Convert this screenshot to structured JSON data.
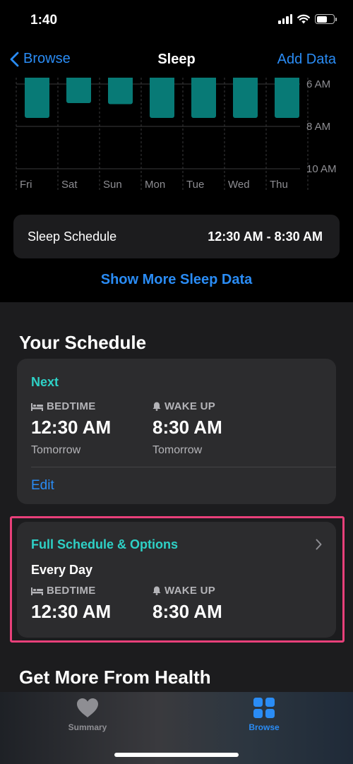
{
  "status_bar": {
    "time": "1:40"
  },
  "nav": {
    "back_label": "Browse",
    "title": "Sleep",
    "action_label": "Add Data"
  },
  "chart_data": {
    "type": "bar",
    "categories": [
      "Fri",
      "Sat",
      "Sun",
      "Mon",
      "Tue",
      "Wed",
      "Thu"
    ],
    "y_tick_labels": [
      "6 AM",
      "8 AM",
      "10 AM"
    ],
    "bar_color": "#087a76",
    "series": [
      {
        "values_end": [
          7.6,
          6.9,
          6.95,
          7.6,
          7.6,
          7.6,
          7.6
        ]
      }
    ]
  },
  "schedule_row": {
    "label": "Sleep Schedule",
    "value": "12:30 AM - 8:30 AM"
  },
  "show_more": "Show More Sleep Data",
  "your_schedule": {
    "title": "Your Schedule",
    "next_card": {
      "heading": "Next",
      "bedtime": {
        "label": "BEDTIME",
        "time": "12:30 AM",
        "sub": "Tomorrow"
      },
      "wakeup": {
        "label": "WAKE UP",
        "time": "8:30 AM",
        "sub": "Tomorrow"
      },
      "edit_label": "Edit"
    },
    "full_card": {
      "heading": "Full Schedule & Options",
      "days": "Every Day",
      "bedtime": {
        "label": "BEDTIME",
        "time": "12:30 AM"
      },
      "wakeup": {
        "label": "WAKE UP",
        "time": "8:30 AM"
      }
    }
  },
  "more_title": "Get More From Health",
  "tabs": [
    {
      "label": "Summary",
      "icon": "heart-icon"
    },
    {
      "label": "Browse",
      "icon": "grid-icon"
    }
  ],
  "colors": {
    "accent_blue": "#2a8cf5",
    "teal": "#2ed1c6",
    "highlight": "#e8407a"
  }
}
